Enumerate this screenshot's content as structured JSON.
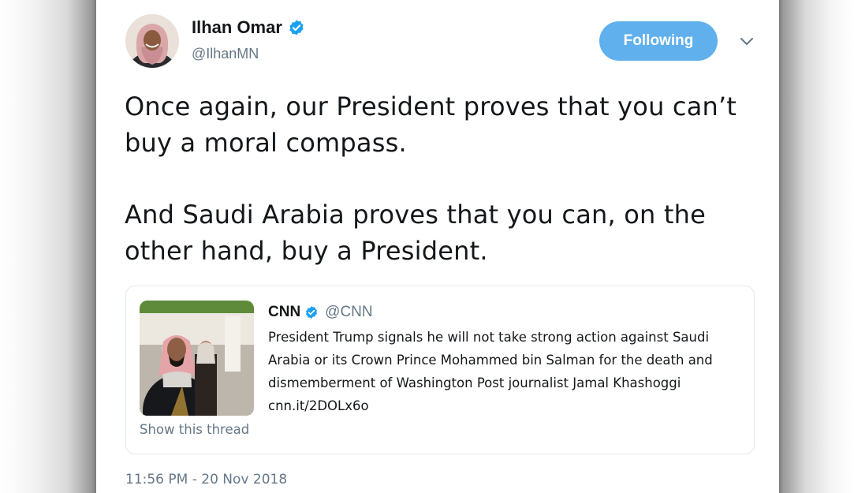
{
  "tweet": {
    "author_name": "Ilhan Omar",
    "author_handle": "@IlhanMN",
    "follow_button_label": "Following",
    "paragraphs": [
      "Once again, our President proves that you can’t buy a moral compass.",
      "And Saudi Arabia proves that you can, on the other hand, buy a President."
    ],
    "timestamp": "11:56 PM - 20 Nov 2018"
  },
  "quoted_tweet": {
    "author_name": "CNN",
    "author_handle": "@CNN",
    "text": "President Trump signals he will not take strong action against Saudi Arabia or its Crown Prince Mohammed bin Salman for the death and dismemberment of Washington Post journalist Jamal Khashoggi cnn.it/2DOLx6o",
    "thread_link": "Show this thread"
  },
  "icons": {
    "verified": "verified-badge-icon",
    "caret": "chevron-down-icon"
  },
  "colors": {
    "follow_button": "#5fb0ec",
    "verified_badge": "#1da1f2",
    "secondary_text": "#657786",
    "primary_text": "#14171a"
  }
}
